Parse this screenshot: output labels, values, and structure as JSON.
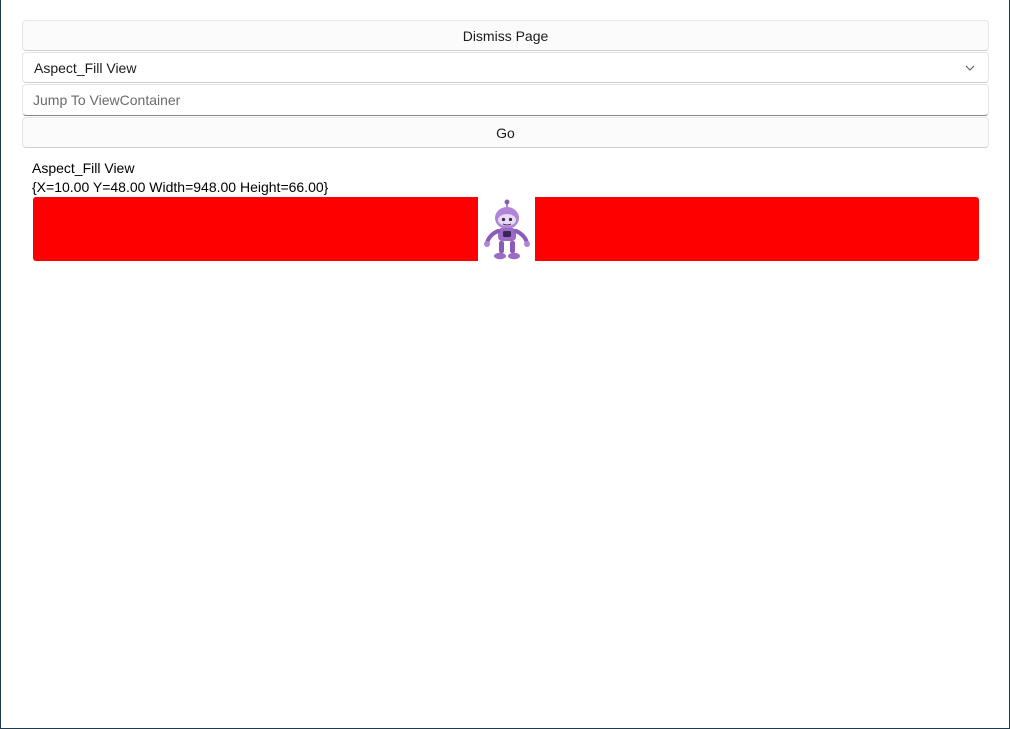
{
  "toolbar": {
    "dismiss_label": "Dismiss Page",
    "go_label": "Go"
  },
  "combo": {
    "selected": "Aspect_Fill View",
    "icon": "chevron-down-icon"
  },
  "jump": {
    "value": "",
    "placeholder": "Jump To ViewContainer"
  },
  "content": {
    "title": "Aspect_Fill View",
    "bounds": "{X=10.00 Y=48.00 Width=948.00 Height=66.00}",
    "image_icon": "robot-mascot-icon"
  },
  "colors": {
    "view_background": "#ff0000",
    "robot_purple": "#9b6bc6"
  }
}
